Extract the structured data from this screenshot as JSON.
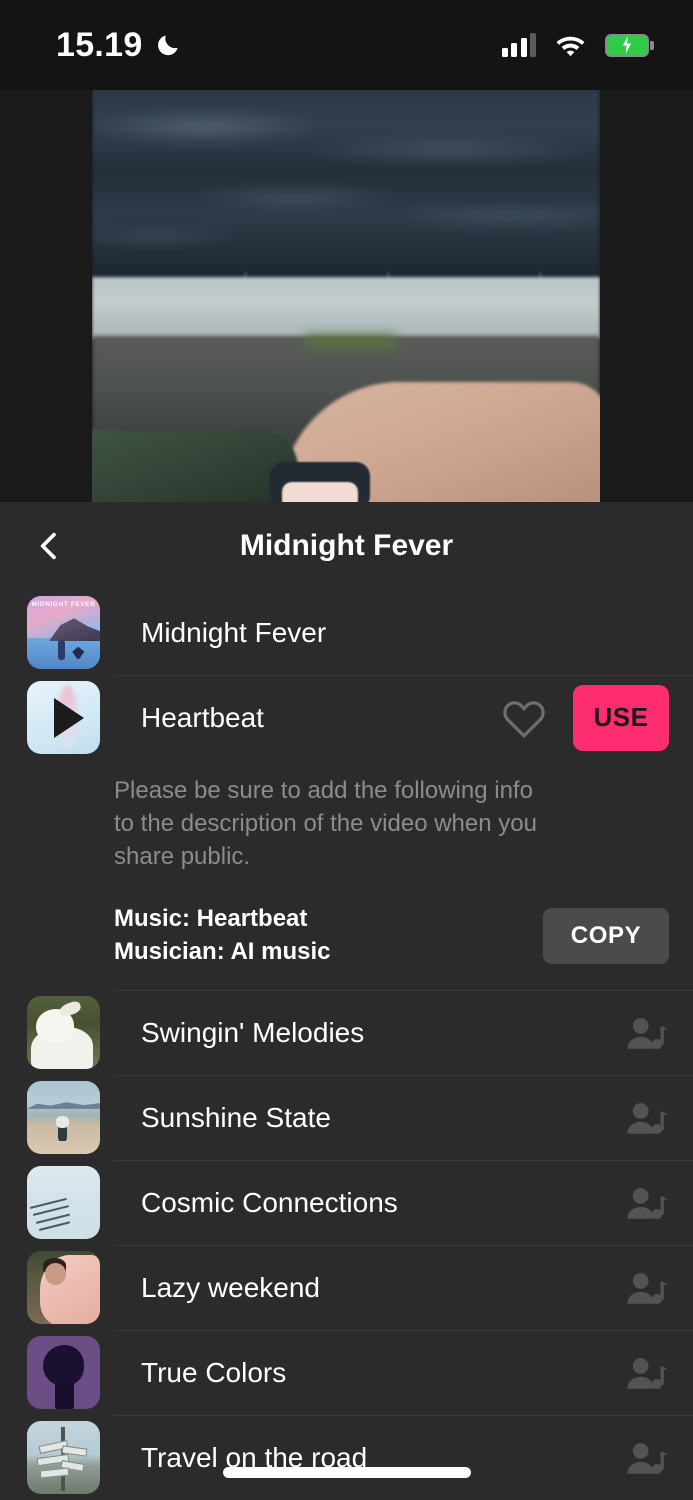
{
  "statusbar": {
    "time": "15.19",
    "dnd_icon": "moon-icon",
    "signal_icon": "cellular-signal-icon",
    "wifi_icon": "wifi-icon",
    "battery_icon": "battery-charging-icon",
    "battery_color": "#2fcc4a"
  },
  "sheet": {
    "back_icon": "chevron-left-icon",
    "title": "Midnight Fever"
  },
  "accent_color": "#fd2d6f",
  "tracks": [
    {
      "title": "Midnight Fever",
      "artwork": "midnight-fever-album-art",
      "artwork_label": "MIDNIGHT FEVER",
      "type": "album",
      "right_icon": ""
    },
    {
      "title": "Heartbeat",
      "artwork": "heartbeat-play-art",
      "type": "selected-track",
      "favorite_icon": "heart-outline-icon",
      "use_label": "USE"
    },
    {
      "title": "Swingin' Melodies",
      "artwork": "goat-photo",
      "type": "track",
      "right_icon": "artist-music-icon"
    },
    {
      "title": " Sunshine State",
      "artwork": "beach-photo",
      "type": "track",
      "right_icon": "artist-music-icon"
    },
    {
      "title": "Cosmic Connections",
      "artwork": "jets-photo",
      "type": "track",
      "right_icon": "artist-music-icon"
    },
    {
      "title": "Lazy weekend",
      "artwork": "saree-portrait-photo",
      "type": "track",
      "right_icon": "artist-music-icon"
    },
    {
      "title": "True Colors",
      "artwork": "purple-head-art",
      "type": "track",
      "right_icon": "artist-music-icon"
    },
    {
      "title": "Travel on the road",
      "artwork": "signpost-photo",
      "type": "track",
      "right_icon": "artist-music-icon"
    }
  ],
  "attribution": {
    "note": "Please be sure to add the following info to the description of the video when you share public.",
    "music_line": "Music: Heartbeat",
    "musician_line": "Musician: AI music",
    "copy_label": "COPY"
  },
  "video_preview": {
    "description": "blurred outdoor video frame with arm and watch"
  },
  "home_indicator": "home-indicator-bar"
}
